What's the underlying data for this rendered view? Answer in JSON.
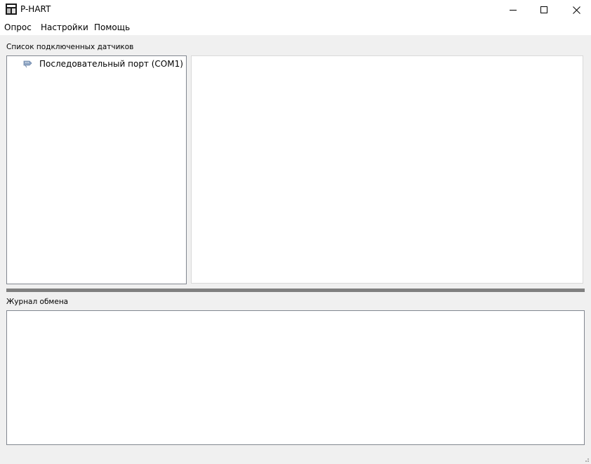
{
  "window": {
    "title": "P-HART",
    "controls": {
      "minimize_icon": "minimize-icon",
      "maximize_icon": "maximize-icon",
      "close_icon": "close-icon"
    }
  },
  "menu": {
    "items": [
      {
        "label": "Опрос"
      },
      {
        "label": "Настройки"
      },
      {
        "label": "Помощь"
      }
    ]
  },
  "sensors": {
    "group_label": "Список подключенных датчиков",
    "tree": [
      {
        "label": "Последовательный порт (COM1)",
        "icon": "serial-port-icon"
      }
    ]
  },
  "log": {
    "group_label": "Журнал обмена"
  },
  "colors": {
    "window_bg": "#f0f0f0",
    "panel_bg": "#ffffff",
    "border": "#828790",
    "splitter": "#808080",
    "port_icon": "#8fa6c4"
  }
}
